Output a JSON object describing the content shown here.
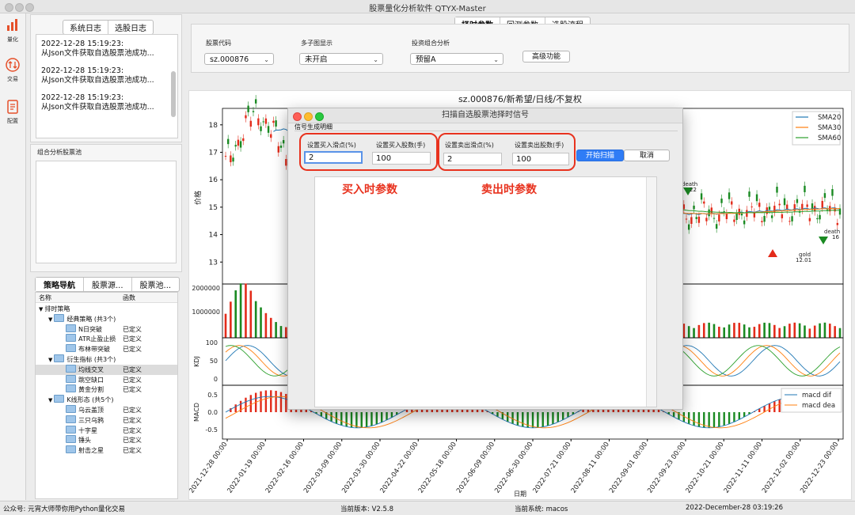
{
  "window": {
    "title": "股票量化分析软件 QTYX-Master"
  },
  "sidebar": {
    "items": [
      {
        "label": "量化",
        "icon": "bar-chart-icon"
      },
      {
        "label": "交易",
        "icon": "trade-arrows-icon"
      },
      {
        "label": "配置",
        "icon": "config-document-icon"
      }
    ]
  },
  "log_panel": {
    "tabs": [
      "系统日志",
      "选股日志"
    ],
    "entries": [
      {
        "time": "2022-12-28 15:19:23:",
        "text": "从Json文件获取自选股票池成功..."
      },
      {
        "time": "2022-12-28 15:19:23:",
        "text": "从Json文件获取自选股票池成功..."
      },
      {
        "time": "2022-12-28 15:19:23:",
        "text": "从Json文件获取自选股票池成功..."
      }
    ]
  },
  "pool_panel": {
    "label": "组合分析股票池"
  },
  "nav_panel": {
    "tabs": [
      "策略导航",
      "股票源...",
      "股票池..."
    ],
    "columns": [
      "名称",
      "函数"
    ],
    "rows": [
      {
        "name": "排时策略",
        "func": "",
        "level": 0,
        "type": "root"
      },
      {
        "name": "经典策略 (共3个)",
        "func": "",
        "level": 1,
        "type": "group"
      },
      {
        "name": "N日突破",
        "func": "已定义",
        "level": 2,
        "type": "leaf"
      },
      {
        "name": "ATR止盈止损",
        "func": "已定义",
        "level": 2,
        "type": "leaf"
      },
      {
        "name": "布林带突破",
        "func": "已定义",
        "level": 2,
        "type": "leaf"
      },
      {
        "name": "衍生指标 (共3个)",
        "func": "",
        "level": 1,
        "type": "group"
      },
      {
        "name": "均线交叉",
        "func": "已定义",
        "level": 2,
        "type": "leaf",
        "selected": true
      },
      {
        "name": "跳空缺口",
        "func": "已定义",
        "level": 2,
        "type": "leaf"
      },
      {
        "name": "黄金分割",
        "func": "已定义",
        "level": 2,
        "type": "leaf"
      },
      {
        "name": "K线形态 (共5个)",
        "func": "",
        "level": 1,
        "type": "group"
      },
      {
        "name": "乌云盖顶",
        "func": "已定义",
        "level": 2,
        "type": "leaf"
      },
      {
        "name": "三只乌鸦",
        "func": "已定义",
        "level": 2,
        "type": "leaf"
      },
      {
        "name": "十字星",
        "func": "已定义",
        "level": 2,
        "type": "leaf"
      },
      {
        "name": "锤头",
        "func": "已定义",
        "level": 2,
        "type": "leaf"
      },
      {
        "name": "射击之星",
        "func": "已定义",
        "level": 2,
        "type": "leaf"
      }
    ]
  },
  "top_tabs": [
    "择时参数",
    "回测参数",
    "选股流程"
  ],
  "controls": {
    "stock_code": {
      "label": "股票代码",
      "value": "sz.000876"
    },
    "multi_display": {
      "label": "多子图显示",
      "value": "未开启"
    },
    "portfolio": {
      "label": "投资组合分析",
      "value": "预留A"
    },
    "advanced_button": "高级功能"
  },
  "chart_title": "sz.000876/新希望/日线/不复权",
  "chart_data": {
    "type": "line",
    "title": "sz.000876/新希望/日线/不复权",
    "ylabel": "价格",
    "ylim": [
      12.2,
      18.6
    ],
    "yticks": [
      13,
      14,
      15,
      16,
      17,
      18
    ],
    "legend": [
      "SMA20",
      "SMA30",
      "SMA60"
    ],
    "legend_colors": [
      "#1f77b4",
      "#ff7f0e",
      "#2ca02c"
    ],
    "x_ticks": [
      "2021-12-28 00:00",
      "2022-01-19 00:00",
      "2022-02-16 00:00",
      "2022-03-09 00:00",
      "2022-03-30 00:00",
      "2022-04-22 00:00",
      "2022-05-18 00:00",
      "2022-06-09 00:00",
      "2022-06-30 00:00",
      "2022-07-21 00:00",
      "2022-08-11 00:00",
      "2022-09-01 00:00",
      "2022-09-23 00:00",
      "2022-10-21 00:00",
      "2022-11-11 00:00",
      "2022-12-02 00:00",
      "2022-12-23 00:00"
    ],
    "volume_ticks": [
      "2000000",
      "1000000"
    ],
    "kdj_label": "KDJ",
    "kdj_ticks": [
      "100",
      "50",
      "0"
    ],
    "macd_label": "MACD",
    "macd_ticks": [
      "0.5",
      "0.0",
      "-0.5"
    ],
    "macd_legend": [
      "macd dif",
      "macd dea"
    ],
    "xlabel": "日期",
    "annotations": [
      {
        "text": "death",
        "sub": "22"
      },
      {
        "text": "death",
        "sub": "16"
      },
      {
        "text": "gold",
        "sub": "12.01"
      }
    ]
  },
  "dialog": {
    "title": "扫描自选股票池择时信号",
    "section": "信号生成明细",
    "buy_slip_label": "设置买入滑点(%)",
    "buy_slip_value": "2",
    "buy_qty_label": "设置买入股数(手)",
    "buy_qty_value": "100",
    "sell_slip_label": "设置卖出滑点(%)",
    "sell_slip_value": "2",
    "sell_qty_label": "设置卖出股数(手)",
    "sell_qty_value": "100",
    "scan_button": "开始扫描",
    "cancel_button": "取消",
    "buy_annotation": "买入时参数",
    "sell_annotation": "卖出时参数"
  },
  "statusbar": {
    "left": "公众号: 元宵大师带你用Python量化交易",
    "version": "当前版本: V2.5.8",
    "system": "当前系统: macos",
    "datetime": "2022-December-28 03:19:26"
  }
}
